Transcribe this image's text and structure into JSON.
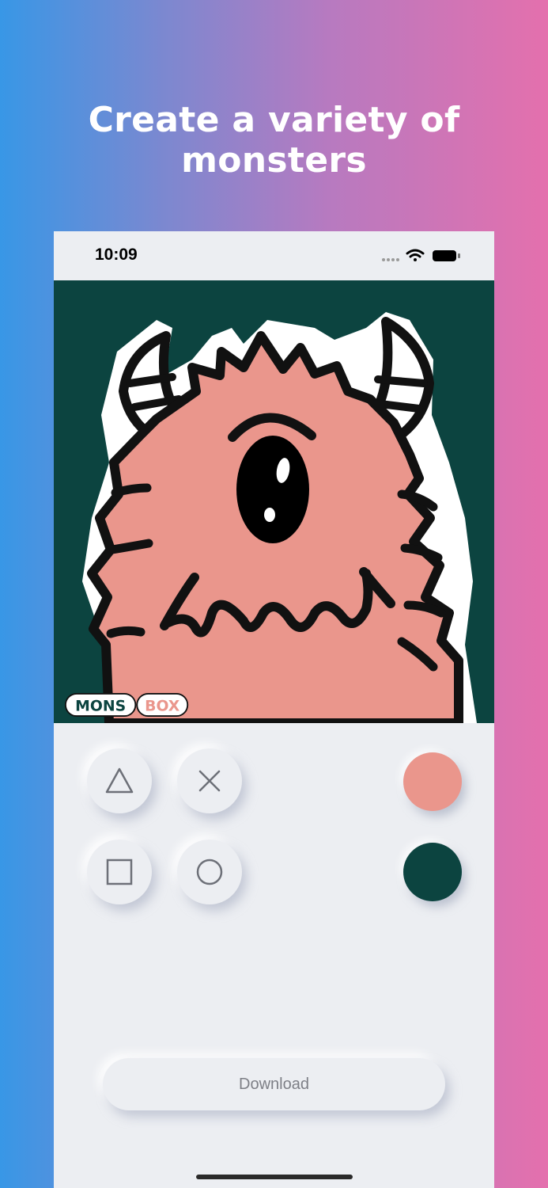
{
  "headline": "Create a variety of monsters",
  "status_bar": {
    "time": "10:09",
    "icons": [
      "signal-dots-icon",
      "wifi-icon",
      "battery-icon"
    ]
  },
  "canvas": {
    "background_color": "#0c4440",
    "monster_color": "#ea968c",
    "logo_text": [
      "MONS",
      "BOX"
    ]
  },
  "shape_buttons": [
    {
      "name": "triangle",
      "icon": "triangle-icon"
    },
    {
      "name": "cross",
      "icon": "cross-icon"
    },
    {
      "name": "square",
      "icon": "square-icon"
    },
    {
      "name": "circle",
      "icon": "circle-icon"
    }
  ],
  "color_swatches": [
    {
      "name": "monster-color",
      "color": "#ea968c"
    },
    {
      "name": "background-color",
      "color": "#0c4440"
    }
  ],
  "download_label": "Download"
}
